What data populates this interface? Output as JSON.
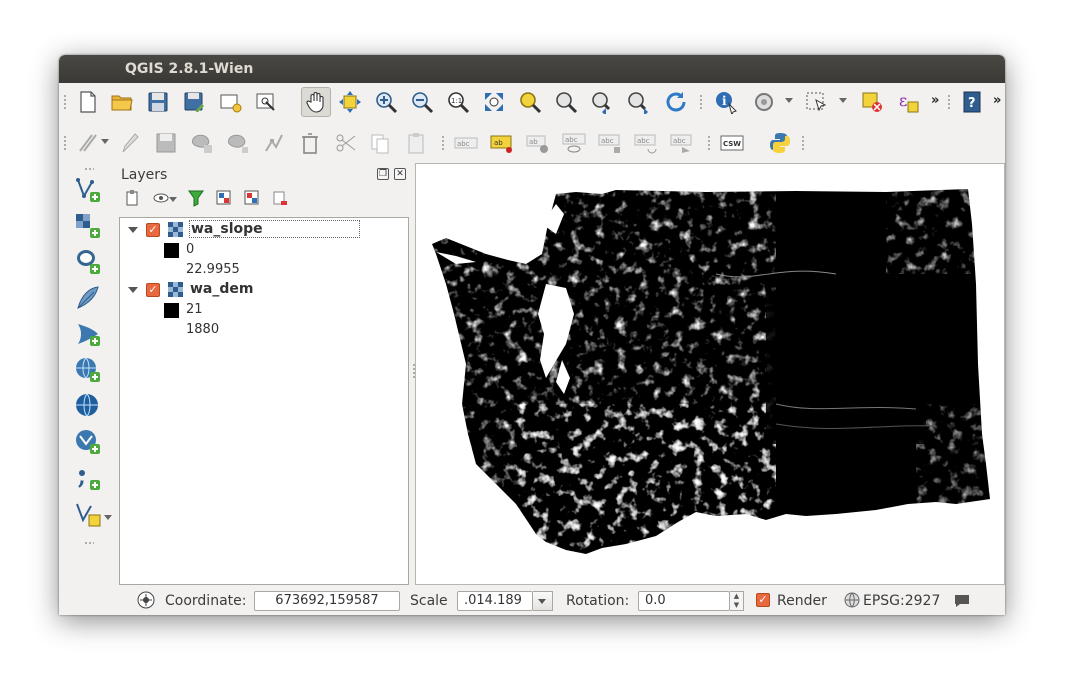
{
  "window": {
    "title": "QGIS 2.8.1-Wien"
  },
  "toolbar1": {
    "buttons": [
      "new-project-icon",
      "open-project-icon",
      "save-project-icon",
      "save-as-icon",
      "new-print-composer-icon",
      "composer-manager-icon",
      "pan-icon",
      "pan-to-selection-icon",
      "zoom-in-icon",
      "zoom-out-icon",
      "zoom-native-icon",
      "zoom-full-icon",
      "zoom-to-selection-icon",
      "zoom-to-layer-icon",
      "zoom-last-icon",
      "zoom-next-icon",
      "refresh-icon",
      "identify-icon",
      "measure-icon",
      "select-icon",
      "deselect-icon",
      "expression-icon",
      "help-icon"
    ],
    "active": "pan-icon",
    "overflow": "»"
  },
  "toolbar2": {
    "buttons": [
      "digitize-icon",
      "edit-pencil-icon",
      "save-edits-icon",
      "add-feature-icon",
      "move-feature-icon",
      "node-tool-icon",
      "delete-icon",
      "cut-icon",
      "copy-icon",
      "paste-icon",
      "label-icon",
      "pin-label-icon",
      "highlight-label-icon",
      "show-hide-label-icon",
      "move-label-icon",
      "rotate-label-icon",
      "change-label-icon",
      "csw-icon",
      "python-icon"
    ],
    "csw_label": "CSW",
    "label_text": "abc",
    "pin_label_text": "ab"
  },
  "left_toolbar": {
    "buttons": [
      "add-vector-layer-icon",
      "add-raster-layer-icon",
      "add-postgis-layer-icon",
      "add-spatialite-layer-icon",
      "add-mssql-layer-icon",
      "add-wms-layer-icon",
      "add-wcs-layer-icon",
      "add-wfs-layer-icon",
      "add-delimited-text-icon",
      "new-shapefile-icon"
    ]
  },
  "layers_panel": {
    "title": "Layers",
    "float_btn": "❐",
    "close_btn": "✕",
    "layers": [
      {
        "name": "wa_slope",
        "checked": true,
        "min": "0",
        "max": "22.9955"
      },
      {
        "name": "wa_dem",
        "checked": true,
        "min": "21",
        "max": "1880"
      }
    ]
  },
  "statusbar": {
    "coordinate_label": "Coordinate:",
    "coordinate_value": "673692,159587",
    "scale_label": "Scale",
    "scale_value": ".014.189",
    "rotation_label": "Rotation:",
    "rotation_value": "0.0",
    "render_label": "Render",
    "render_checked": true,
    "crs_label": "EPSG:2927"
  },
  "colors": {
    "titlebar": "#3c3b37",
    "accent_check": "#e9683d",
    "window_bg": "#f2f1f0"
  }
}
